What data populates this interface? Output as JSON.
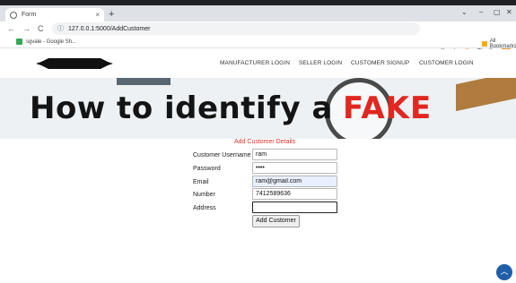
{
  "browser": {
    "tab_title": "Form",
    "tab_close": "×",
    "new_tab": "+",
    "url": "127.0.0.1:5000/AddCustomer",
    "bookmark": "sgvale - Google Sh...",
    "all_bookmarks": "All Bookmarks",
    "profile_initial": "!",
    "window_controls": [
      "⌄",
      "–",
      "▢",
      "✕"
    ],
    "nav_icons": [
      "←",
      "→",
      "C"
    ]
  },
  "site": {
    "nav_links": [
      "MANUFACTURER LOGIN",
      "SELLER LOGIN",
      "CUSTOMER SIGNUP",
      "CUSTOMER LOGIN"
    ],
    "banner_text": "How to identify a",
    "banner_highlight": "FAKE"
  },
  "form": {
    "title": "Add Customer Details",
    "fields": [
      {
        "label": "Customer Username",
        "value": "ram"
      },
      {
        "label": "Password",
        "value": "••••"
      },
      {
        "label": "Email",
        "value": "ram@gmail.com"
      },
      {
        "label": "Number",
        "value": "7412589636"
      },
      {
        "label": "Address",
        "value": ""
      }
    ],
    "submit_label": "Add Customer"
  },
  "colors": {
    "accent_red": "#e0312b",
    "scroll_button": "#1f5fa8"
  }
}
